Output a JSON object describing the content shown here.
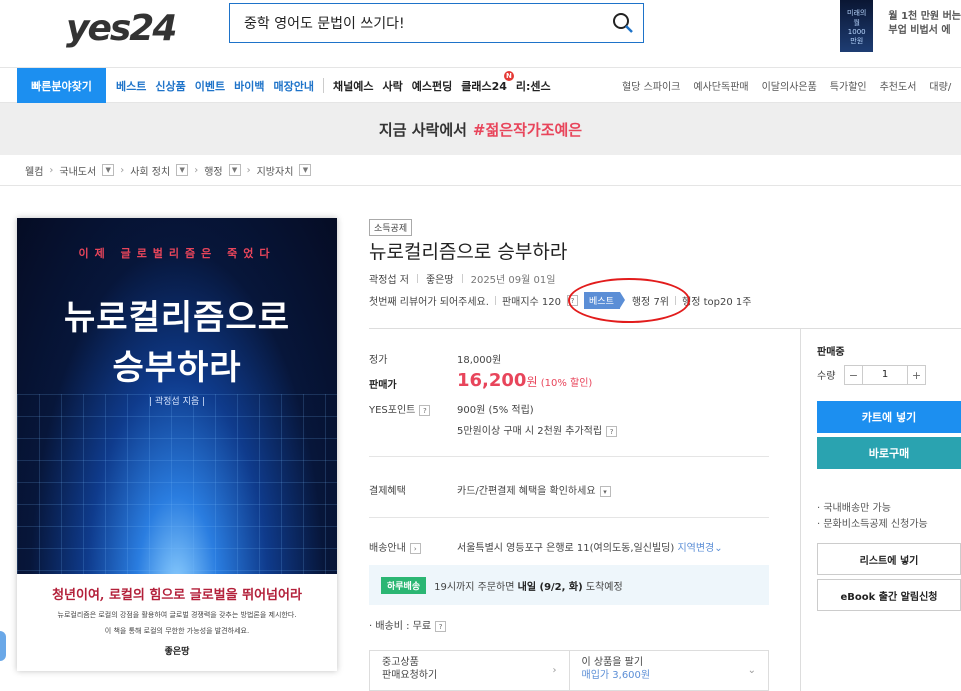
{
  "header": {
    "logo": "yes24",
    "search_value": "중학 영어도 문법이 쓰기다!",
    "promo_line1": "월 1천 만원 버는",
    "promo_line2": "부업 비법서 에",
    "promo_thumb": "미래의 월1000만원"
  },
  "nav": {
    "quick": "빠른분야찾기",
    "blue_items": [
      "베스트",
      "신상품",
      "이벤트",
      "바이백",
      "매장안내"
    ],
    "dark_items": [
      "채널예스",
      "사락",
      "예스펀딩",
      "클래스24",
      "리:센스"
    ],
    "new_badge": "N",
    "right_items": [
      "혈당 스파이크",
      "예사단독판매",
      "이달의사은품",
      "특가할인",
      "추천도서",
      "대량/"
    ]
  },
  "banner": {
    "text": "지금 사락에서",
    "highlight": "#젊은작가조예은"
  },
  "breadcrumb": [
    "웰컴",
    "국내도서",
    "사회 정치",
    "행정",
    "지방자치"
  ],
  "cover": {
    "subtitle": "이제 글로벌리즘은 죽었다",
    "title_line1": "뉴로컬리즘으로",
    "title_line2": "승부하라",
    "author": "| 곽정섭 지음 |",
    "tagline": "청년이여, 로컬의 힘으로 글로벌을 뛰어넘어라",
    "desc1": "뉴로컬리즘은 로컬의 강점을 활용하여 글로벌 경쟁력을 갖추는 방법론을 제시한다.",
    "desc2": "이 책을 통해 로컬의 무한한 가능성을 발견하세요.",
    "publisher": "좋은땅"
  },
  "product": {
    "tag": "소득공제",
    "title": "뉴로컬리즘으로 승부하라",
    "author": "곽정섭 저",
    "publisher": "좋은땅",
    "date": "2025년 09월 01일",
    "review": "첫번째 리뷰어가 되어주세요.",
    "sales_index": "판매지수 120",
    "best_badge": "베스트",
    "rank1": "행정 7위",
    "rank2": "행정 top20 1주",
    "q": "?"
  },
  "price": {
    "list_label": "정가",
    "list_value": "18,000원",
    "sale_label": "판매가",
    "sale_value": "16,200",
    "sale_unit": "원",
    "discount": "(10% 할인)",
    "point_label": "YES포인트",
    "point_value": "900원 (5% 적립)",
    "point_extra": "5만원이상 구매 시 2천원 추가적립"
  },
  "benefit": {
    "label": "결제혜택",
    "value": "카드/간편결제 혜택을 확인하세요"
  },
  "delivery": {
    "label": "배송안내",
    "address": "서울특별시 영등포구 은행로 11(여의도동,일신빌딩)",
    "change": "지역변경",
    "badge": "하루배송",
    "text_pre": "19시까지 주문하면",
    "text_bold": "내일 (9/2, 화)",
    "text_post": "도착예정",
    "fee": "· 배송비 : 무료"
  },
  "bottom": {
    "used_line1": "중고상품",
    "used_line2": "판매요청하기",
    "sell_line1": "이 상품을 팔기",
    "sell_line2": "매입가 3,600원"
  },
  "side": {
    "status": "판매중",
    "qty_label": "수량",
    "qty_value": "1",
    "minus": "−",
    "plus": "+",
    "cart": "카트에 넣기",
    "buy": "바로구매",
    "note1": "· 국내배송만 가능",
    "note2": "· 문화비소득공제 신청가능",
    "list": "리스트에 넣기",
    "ebook": "eBook 출간 알림신청"
  }
}
